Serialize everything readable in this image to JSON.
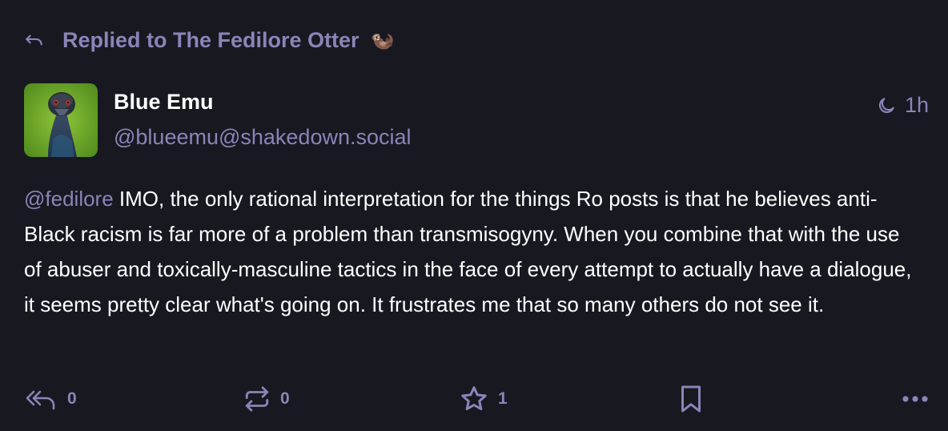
{
  "reply_context": {
    "text": "Replied to The Fedilore Otter",
    "emoji": "🦦"
  },
  "author": {
    "display_name": "Blue Emu",
    "handle": "@blueemu@shakedown.social"
  },
  "timestamp": {
    "icon": "moon-icon",
    "text": "1h"
  },
  "post": {
    "mention": "@fedilore",
    "text": " IMO, the only rational interpretation for the things Ro posts is that he believes anti-Black racism is far more of a problem than transmisogyny. When you combine that with the use of abuser and toxically-masculine tactics in the face of every attempt to actually have a dialogue, it seems pretty clear what's going on. It frustrates me that so many others do not see it."
  },
  "actions": {
    "reply_count": "0",
    "boost_count": "0",
    "favourite_count": "1"
  },
  "colors": {
    "background": "#181821",
    "muted": "#8985b8",
    "text": "#ffffff"
  }
}
